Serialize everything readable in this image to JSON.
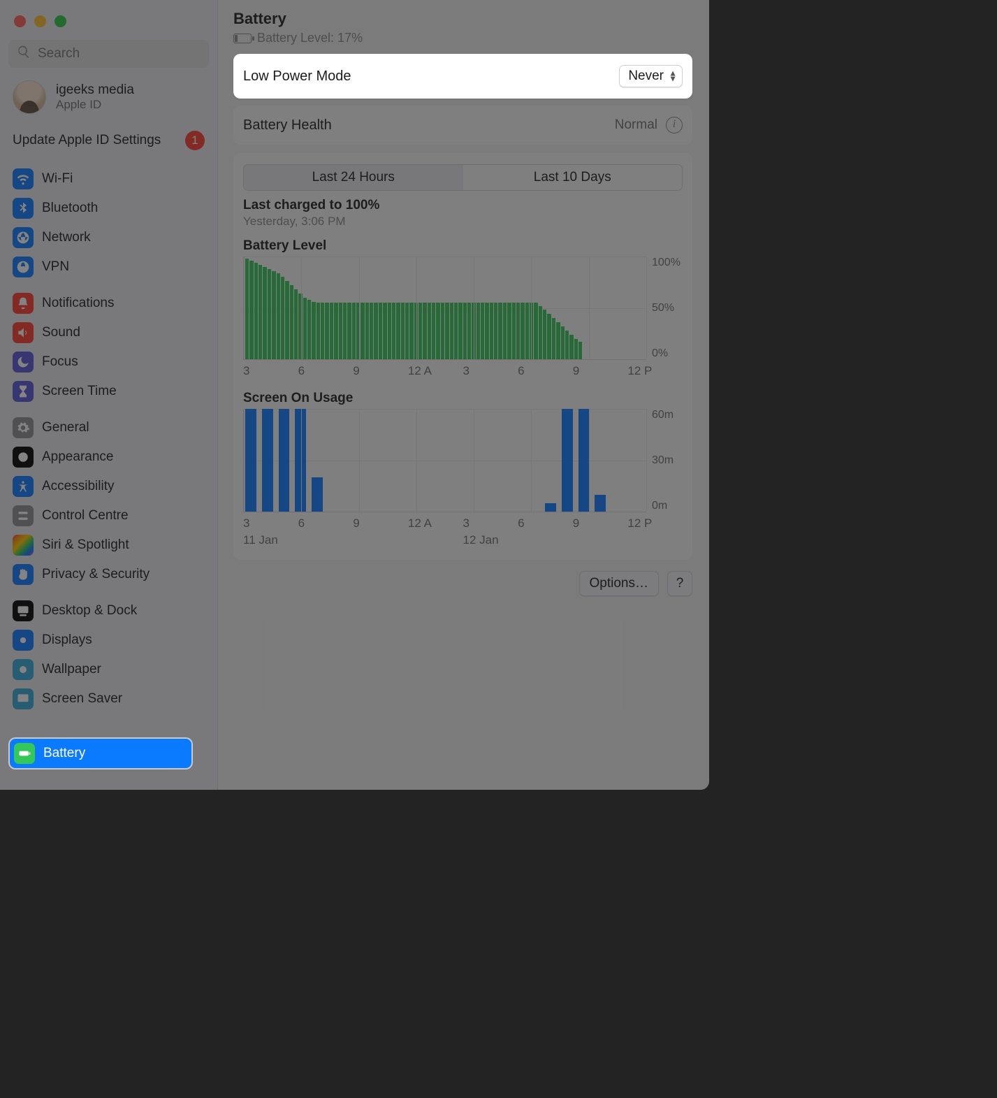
{
  "search": {
    "placeholder": "Search"
  },
  "user": {
    "name": "igeeks media",
    "sub": "Apple ID"
  },
  "update": {
    "label": "Update Apple ID Settings",
    "badge": "1"
  },
  "sidebar": {
    "items": [
      {
        "label": "Wi-Fi"
      },
      {
        "label": "Bluetooth"
      },
      {
        "label": "Network"
      },
      {
        "label": "VPN"
      },
      {
        "label": "Notifications"
      },
      {
        "label": "Sound"
      },
      {
        "label": "Focus"
      },
      {
        "label": "Screen Time"
      },
      {
        "label": "General"
      },
      {
        "label": "Appearance"
      },
      {
        "label": "Accessibility"
      },
      {
        "label": "Control Centre"
      },
      {
        "label": "Siri & Spotlight"
      },
      {
        "label": "Privacy & Security"
      },
      {
        "label": "Desktop & Dock"
      },
      {
        "label": "Displays"
      },
      {
        "label": "Wallpaper"
      },
      {
        "label": "Screen Saver"
      },
      {
        "label": "Battery"
      }
    ]
  },
  "header": {
    "title": "Battery",
    "level_label": "Battery Level: 17%"
  },
  "lpm": {
    "label": "Low Power Mode",
    "value": "Never"
  },
  "health": {
    "label": "Battery Health",
    "value": "Normal"
  },
  "seg": {
    "a": "Last 24 Hours",
    "b": "Last 10 Days"
  },
  "charge": {
    "title": "Last charged to 100%",
    "sub": "Yesterday, 3:06 PM"
  },
  "chart1": {
    "title": "Battery Level"
  },
  "chart2": {
    "title": "Screen On Usage"
  },
  "xticks": [
    "3",
    "6",
    "9",
    "12 A",
    "3",
    "6",
    "9",
    "12 P"
  ],
  "y1": [
    "100%",
    "50%",
    "0%"
  ],
  "y2": [
    "60m",
    "30m",
    "0m"
  ],
  "dates": [
    "11 Jan",
    "12 Jan"
  ],
  "buttons": {
    "options": "Options…",
    "help": "?"
  },
  "chart_data": [
    {
      "type": "bar",
      "title": "Battery Level",
      "ylabel": "%",
      "ylim": [
        0,
        100
      ],
      "xticks": [
        "3",
        "6",
        "9",
        "12 A",
        "3",
        "6",
        "9",
        "12 P"
      ],
      "values": [
        98,
        96,
        94,
        92,
        90,
        88,
        86,
        84,
        80,
        76,
        72,
        68,
        64,
        60,
        58,
        56,
        55,
        55,
        55,
        55,
        55,
        55,
        55,
        55,
        55,
        55,
        55,
        55,
        55,
        55,
        55,
        55,
        55,
        55,
        55,
        55,
        55,
        55,
        55,
        55,
        55,
        55,
        55,
        55,
        55,
        55,
        55,
        55,
        55,
        55,
        55,
        55,
        55,
        55,
        55,
        55,
        55,
        55,
        55,
        55,
        55,
        55,
        55,
        55,
        55,
        55,
        52,
        48,
        44,
        40,
        36,
        32,
        28,
        24,
        20,
        17,
        0,
        0,
        0,
        0,
        0,
        0,
        0,
        0,
        0,
        0,
        0,
        0,
        0,
        0
      ]
    },
    {
      "type": "bar",
      "title": "Screen On Usage",
      "ylabel": "minutes",
      "ylim": [
        0,
        60
      ],
      "xticks": [
        "3",
        "6",
        "9",
        "12 A",
        "3",
        "6",
        "9",
        "12 P"
      ],
      "dates": [
        "11 Jan",
        "12 Jan"
      ],
      "series": [
        {
          "name": "Screen On",
          "values": [
            60,
            60,
            60,
            60,
            20,
            0,
            0,
            0,
            0,
            0,
            0,
            0,
            0,
            0,
            0,
            0,
            0,
            0,
            5,
            60,
            60,
            10,
            0,
            0
          ]
        }
      ]
    }
  ]
}
